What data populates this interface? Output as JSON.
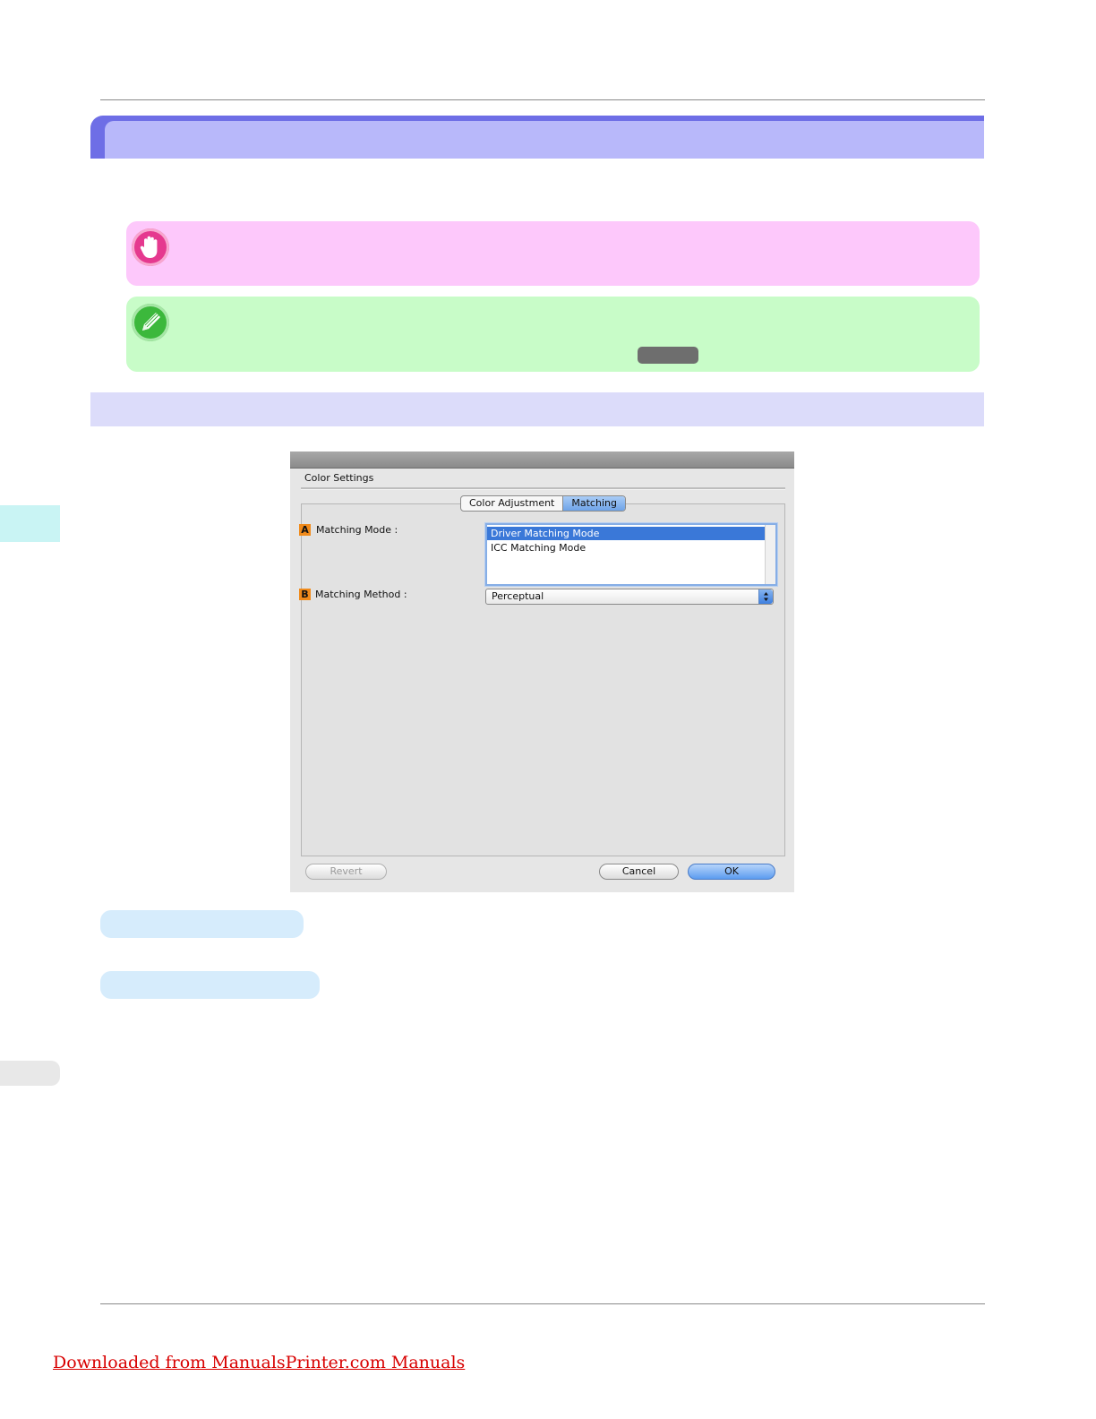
{
  "footer": {
    "download_link": "Downloaded from ManualsPrinter.com Manuals"
  },
  "dialog": {
    "caption": "Color Settings",
    "tabs": [
      {
        "label": "Color Adjustment",
        "selected": false
      },
      {
        "label": "Matching",
        "selected": true
      }
    ],
    "matching_mode": {
      "badge": "A",
      "label": "Matching Mode :",
      "options": [
        "Driver Matching Mode",
        "ICC Matching Mode"
      ],
      "selected": "Driver Matching Mode"
    },
    "matching_method": {
      "badge": "B",
      "label": "Matching Method :",
      "value": "Perceptual"
    },
    "buttons": {
      "revert": "Revert",
      "cancel": "Cancel",
      "ok": "OK"
    }
  },
  "icons": {
    "important": "important-hand-icon",
    "note": "note-pencil-icon"
  },
  "colors": {
    "title_bar": "#6e6ee6",
    "important_box": "#fdc8fb",
    "note_box": "#c8fcc8",
    "selection": "#3a78d8",
    "link": "#d80000"
  }
}
